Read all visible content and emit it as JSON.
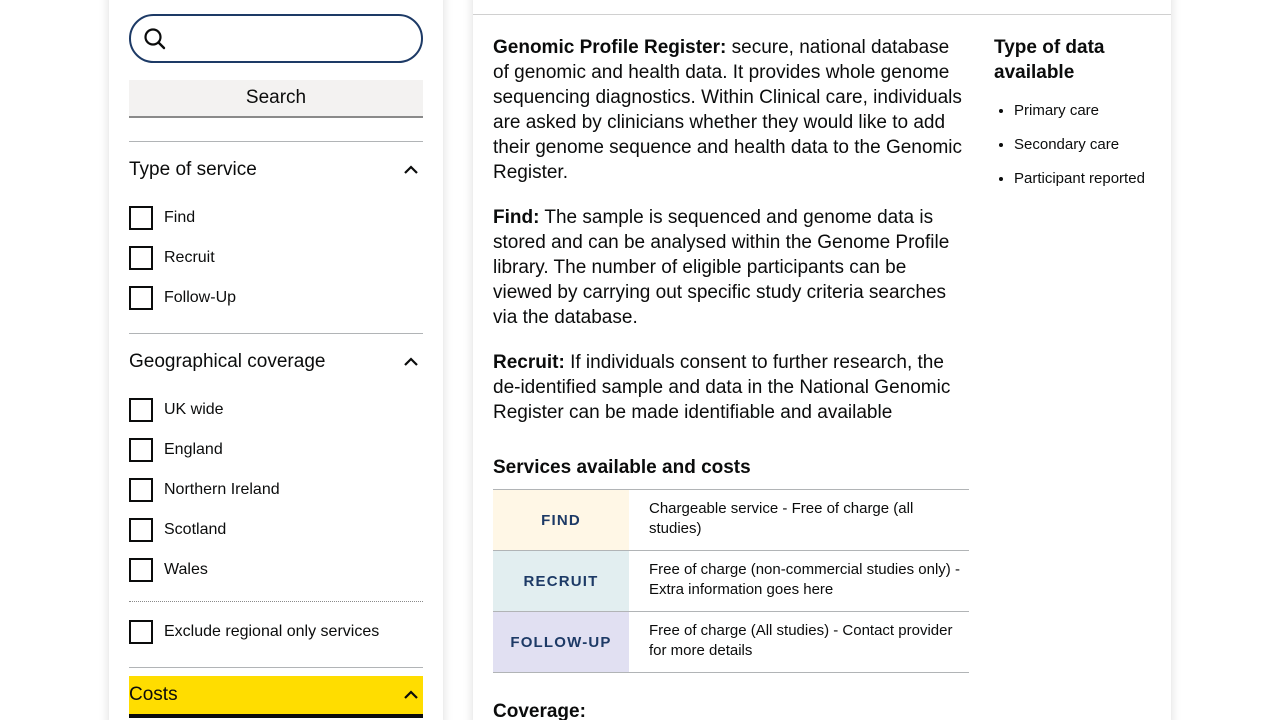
{
  "search": {
    "placeholder": "",
    "value": "",
    "button_label": "Search"
  },
  "filters": {
    "type_of_service": {
      "title": "Type of service",
      "options": [
        "Find",
        "Recruit",
        "Follow-Up"
      ]
    },
    "geographical_coverage": {
      "title": "Geographical coverage",
      "options": [
        "UK wide",
        "England",
        "Northern Ireland",
        "Scotland",
        "Wales"
      ],
      "exclude_label": "Exclude regional only services"
    },
    "costs": {
      "title": "Costs"
    }
  },
  "main": {
    "paragraphs": [
      {
        "label": "Genomic Profile Register:",
        "text": " secure, national database of genomic and health data. It provides whole genome sequencing diagnostics. Within Clinical care, individuals are asked by clinicians whether they would like to add their genome sequence and health data to the Genomic Register."
      },
      {
        "label": "Find:",
        "text": " The sample is sequenced and genome data is stored and can be analysed within the Genome Profile library. The number of eligible participants can be viewed by carrying out specific study criteria searches via the database."
      },
      {
        "label": "Recruit:",
        "text": " If individuals consent to further research, the de-identified sample and data in the National Genomic Register can be made identifiable and available"
      }
    ],
    "services_heading": "Services available and costs",
    "services": [
      {
        "tag": "FIND",
        "color": "#fff7e6",
        "description": "Chargeable service - Free of charge (all studies)"
      },
      {
        "tag": "RECRUIT",
        "color": "#e2eef0",
        "description": "Free of charge (non-commercial studies only) - Extra information goes here"
      },
      {
        "tag": "FOLLOW-UP",
        "color": "#e1e0f2",
        "description": "Free of charge (All studies) - Contact provider for more details"
      }
    ],
    "coverage_label": "Coverage:"
  },
  "aside": {
    "title": "Type of data available",
    "items": [
      "Primary care",
      "Secondary care",
      "Participant reported"
    ]
  },
  "colors": {
    "accent": "#1d3a66",
    "highlight": "#ffdd00",
    "text": "#0b0c0c"
  },
  "icons": {
    "search": "search-icon",
    "expand": "chevron-up-icon"
  }
}
